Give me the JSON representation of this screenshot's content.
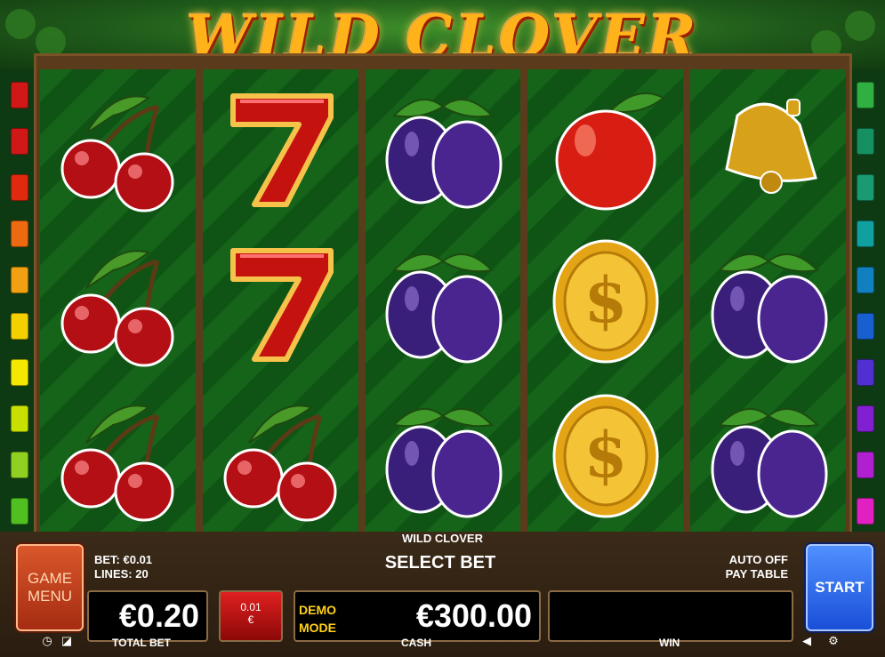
{
  "header": {
    "title": "WILD CLOVER"
  },
  "reels": [
    [
      "cherry",
      "cherry",
      "cherry"
    ],
    [
      "seven",
      "seven",
      "cherry"
    ],
    [
      "plum",
      "plum",
      "plum"
    ],
    [
      "apple",
      "dollar-coin",
      "dollar-coin"
    ],
    [
      "bell",
      "plum",
      "plum"
    ]
  ],
  "colors": {
    "left_lines": [
      "#d01818",
      "#d01818",
      "#e02a10",
      "#ee6a10",
      "#f0a010",
      "#f5d000",
      "#f5e800",
      "#c8e000",
      "#90d020",
      "#50c020"
    ],
    "right_lines": [
      "#30b040",
      "#169060",
      "#1a9a70",
      "#10a0a0",
      "#1080c0",
      "#1860d0",
      "#5030d0",
      "#8020d0",
      "#b020d0",
      "#e020c0"
    ]
  },
  "controls": {
    "game_menu": [
      "GAME",
      "MENU"
    ],
    "bar_title": "WILD CLOVER",
    "bet_label": "BET: €0.01",
    "lines_label": "LINES: 20",
    "select_bet": "SELECT BET",
    "auto": "AUTO OFF",
    "pay_table": "PAY TABLE",
    "start": "START",
    "total_bet_value": "€0.20",
    "total_bet_label": "TOTAL BET",
    "chip_value": "0.01",
    "chip_currency": "€",
    "demo": [
      "DEMO",
      "MODE"
    ],
    "cash_value": "€300.00",
    "cash_label": "CASH",
    "win_value": "",
    "win_label": "WIN"
  }
}
